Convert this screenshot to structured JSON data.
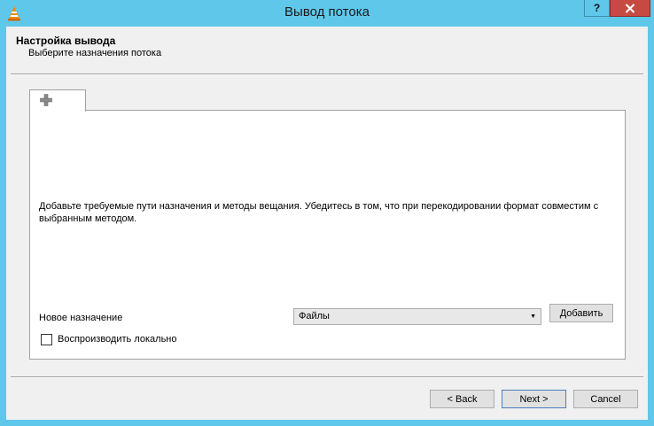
{
  "window": {
    "title": "Вывод потока",
    "help_label": "?",
    "accent_color": "#5fc8ea",
    "close_color": "#c74a42"
  },
  "icons": {
    "app": "vlc-cone-icon",
    "tab": "plus-icon",
    "close": "close-icon",
    "select": "dropdown-arrow-icon"
  },
  "header": {
    "title": "Настройка вывода",
    "subtitle": "Выберите назначения потока"
  },
  "panel": {
    "info": "Добавьте требуемые пути назначения и методы вещания. Убедитесь в том, что при перекодировании формат совместим с выбранным методом.",
    "new_destination_label": "Новое назначение",
    "destination_selected": "Файлы",
    "add_label": "Добавить",
    "play_locally_label": "Воспроизводить локально",
    "play_locally_checked": false
  },
  "footer": {
    "back_label": "< Back",
    "next_label": "Next >",
    "cancel_label": "Cancel"
  }
}
